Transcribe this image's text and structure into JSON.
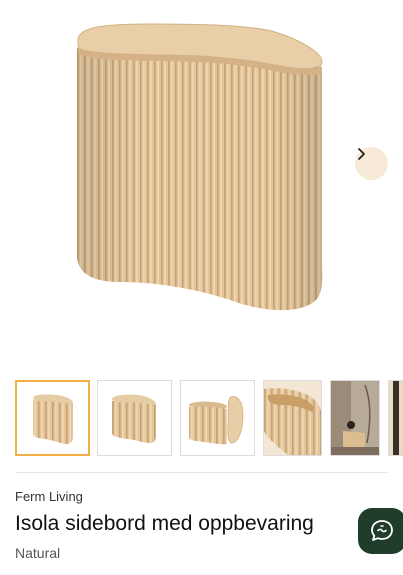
{
  "product": {
    "brand": "Ferm Living",
    "title": "Isola sidebord med oppbevaring",
    "variant": "Natural"
  },
  "gallery": {
    "thumbnail_count": 6,
    "active_index": 0
  },
  "colors": {
    "wood": "#e2c398",
    "wood_dark": "#c9a473",
    "accent_border": "#f0b046",
    "next_bg": "#f7ead6",
    "chat_bg": "#1f3d2a"
  },
  "icons": {
    "next": "chevron-right-icon",
    "chat": "chat-bubble-icon"
  }
}
